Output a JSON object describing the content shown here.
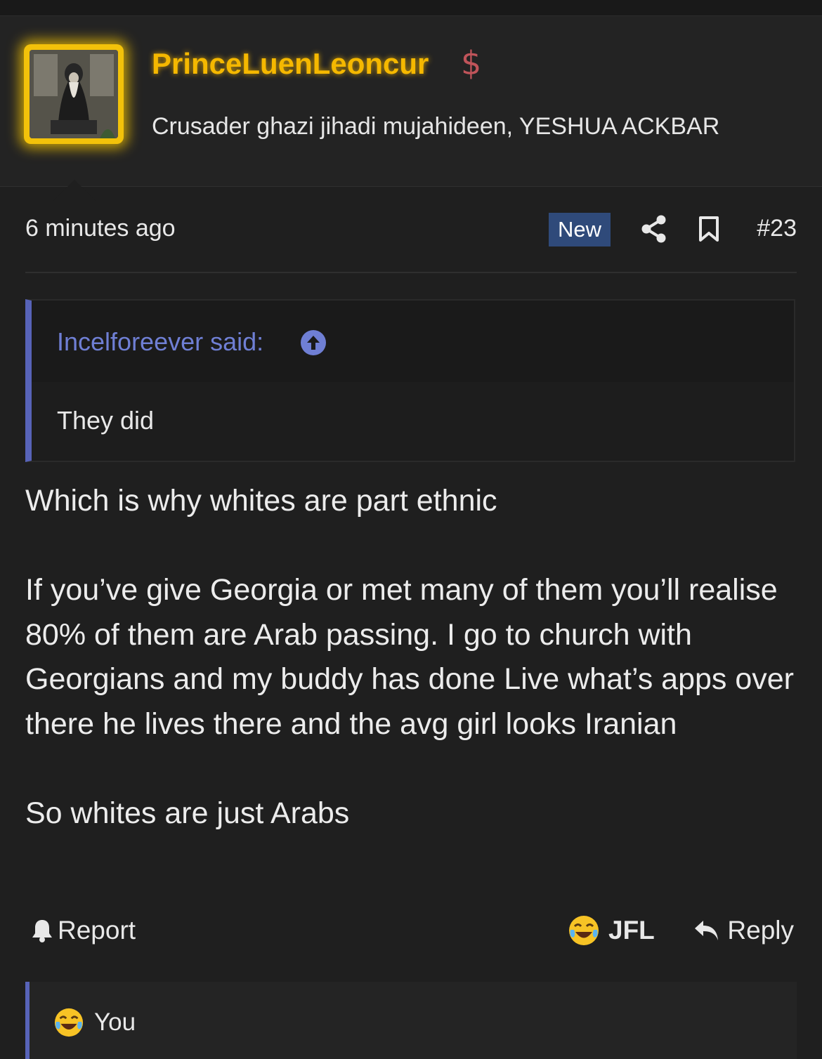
{
  "user": {
    "username": "PrinceLuenLeoncur",
    "title": "Crusader ghazi jihadi mujahideen, YESHUA ACKBAR",
    "dollar_symbol": "$",
    "accent_color": "#f5b800"
  },
  "post": {
    "time": "6 minutes ago",
    "new_badge": "New",
    "number": "#23",
    "quote": {
      "author": "Incelforeever said:",
      "text": "They did"
    },
    "message": {
      "line1": "Which is why whites are part ethnic",
      "para2": "If you’ve give Georgia or met many of them you’ll realise 80% of them are Arab passing. I go to church with Georgians and my buddy has done Live what’s apps over there he lives there and the avg girl looks Iranian",
      "line3": "So whites are just Arabs"
    }
  },
  "actions": {
    "report": "Report",
    "jfl": "JFL",
    "reply": "Reply"
  },
  "reactions": {
    "label": "You"
  },
  "icons": [
    "share-icon",
    "bookmark-icon",
    "bell-icon",
    "reply-arrow-icon",
    "tears-of-joy-emoji",
    "up-arrow-icon",
    "dollar-icon"
  ]
}
